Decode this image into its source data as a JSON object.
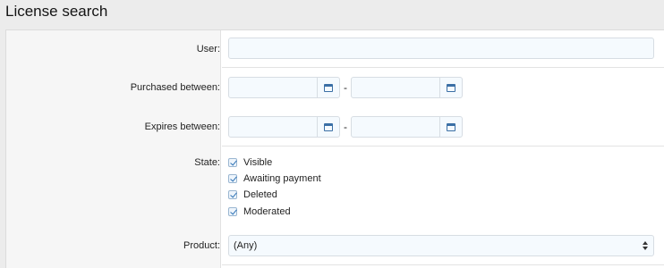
{
  "page": {
    "title": "License search"
  },
  "form": {
    "user": {
      "label": "User:",
      "value": "",
      "placeholder": ""
    },
    "purchased": {
      "label": "Purchased between:",
      "start": {
        "value": "",
        "icon": "calendar-icon"
      },
      "separator": "-",
      "end": {
        "value": "",
        "icon": "calendar-icon"
      }
    },
    "expires": {
      "label": "Expires between:",
      "start": {
        "value": "",
        "icon": "calendar-icon"
      },
      "separator": "-",
      "end": {
        "value": "",
        "icon": "calendar-icon"
      }
    },
    "state": {
      "label": "State:",
      "options": [
        {
          "label": "Visible",
          "checked": true
        },
        {
          "label": "Awaiting payment",
          "checked": true
        },
        {
          "label": "Deleted",
          "checked": true
        },
        {
          "label": "Moderated",
          "checked": true
        }
      ]
    },
    "product": {
      "label": "Product:",
      "selected": "(Any)"
    }
  },
  "colors": {
    "accent": "#2f73b5",
    "input_bg": "#f5fafe",
    "label_column_bg": "#f6f6f6",
    "page_bg": "#ececec"
  }
}
